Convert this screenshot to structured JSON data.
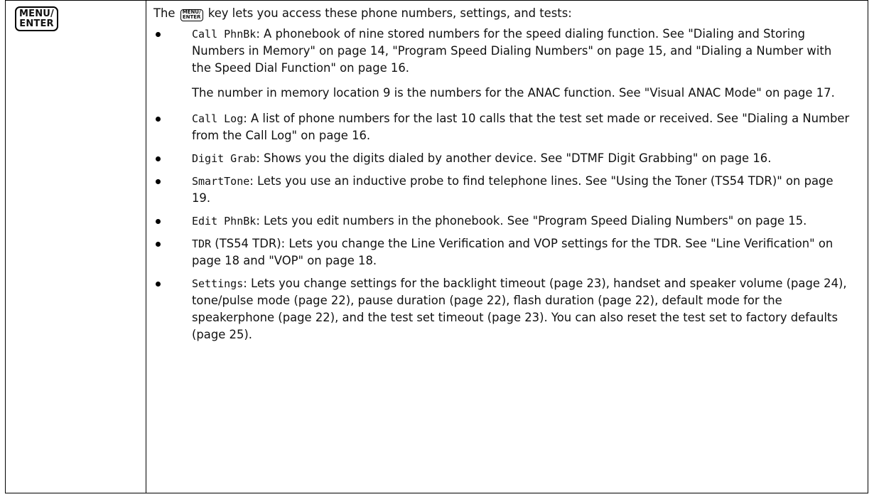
{
  "key": {
    "line1": "MENU/",
    "line2": "ENTER"
  },
  "intro": {
    "prefix": "The",
    "suffix": "key lets you access these phone numbers, settings, and tests:"
  },
  "items": [
    {
      "label": "Call PhnBk",
      "text": ": A phonebook of nine stored numbers for the speed dialing function. See \"Dialing and Storing Numbers in Memory\" on page 14, \"Program Speed Dialing Numbers\" on page 15, and \"Dialing a Number with the Speed Dial Function\" on page 16.",
      "note": "The number in memory location 9 is the numbers for the ANAC function. See \"Visual ANAC Mode\" on page 17."
    },
    {
      "label": "Call Log",
      "text": ": A list of phone numbers for the last 10 calls that the test set made or received. See \"Dialing a Number from the Call Log\" on page 16."
    },
    {
      "label": "Digit Grab",
      "text": ": Shows you the digits dialed by another device. See \"DTMF Digit Grabbing\" on page 16."
    },
    {
      "label": "SmartTone",
      "text": ": Lets you use an inductive probe to find telephone lines. See \"Using the Toner (TS54 TDR)\" on page 19."
    },
    {
      "label": "Edit PhnBk",
      "text": ": Lets you edit numbers in the phonebook. See \"Program Speed Dialing Numbers\" on page 15."
    },
    {
      "label": "TDR",
      "text": " (TS54 TDR): Lets you change the Line Verification and VOP settings for the TDR. See \"Line Verification\" on page 18 and \"VOP\" on page 18."
    },
    {
      "label": "Settings",
      "text": ": Lets you change settings for the backlight timeout (page 23), handset and speaker volume (page 24), tone/pulse mode (page 22), pause duration (page 22), flash duration (page 22), default mode for the speakerphone (page 22), and the test set timeout (page 23). You can also reset the test set to factory defaults (page 25)."
    }
  ]
}
